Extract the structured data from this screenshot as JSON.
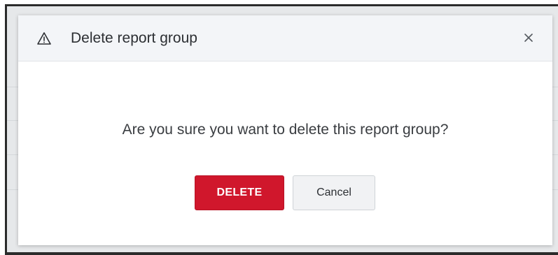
{
  "dialog": {
    "title": "Delete report group",
    "icon": "warning-icon",
    "close_icon": "close-icon",
    "message": "Are you sure you want to delete this report group?",
    "buttons": {
      "delete_label": "DELETE",
      "cancel_label": "Cancel"
    }
  },
  "colors": {
    "danger": "#d0172c",
    "header_bg": "#f3f5f8",
    "text": "#2c2f33"
  }
}
